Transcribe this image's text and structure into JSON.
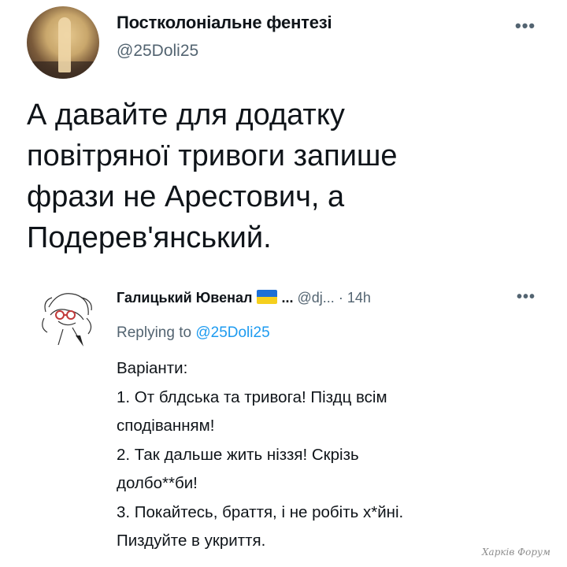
{
  "main_tweet": {
    "display_name": "Постколоніальне фентезі",
    "handle": "@25Doli25",
    "more_icon": "•••",
    "text_lines": [
      "А давайте для додатку",
      "повітряної тривоги запише",
      "фрази не Арестович, а",
      "Подерев'янський."
    ]
  },
  "reply": {
    "display_name": "Галицький Ювенал",
    "flag_icon": "ukraine-flag",
    "ellipsis": "...",
    "handle": "@dj...",
    "separator": "·",
    "time": "14h",
    "more_icon": "•••",
    "replying_prefix": "Replying to",
    "replying_handle": "@25Doli25",
    "body_lines": [
      "Варіанти:",
      "1. От блдська та тривога! Піздц всім",
      "сподіванням!",
      "2. Так дальше жить ніззя! Скрізь",
      "долбо**би!",
      "3. Покайтесь, браття, і не робіть х*йні.",
      "Пиздуйте в  укриття."
    ]
  },
  "watermark": "Харків Форум",
  "colors": {
    "text": "#0f1419",
    "muted": "#536471",
    "link": "#1d9bf0",
    "flag_blue": "#1d6fd6",
    "flag_yellow": "#f5cf1d"
  }
}
